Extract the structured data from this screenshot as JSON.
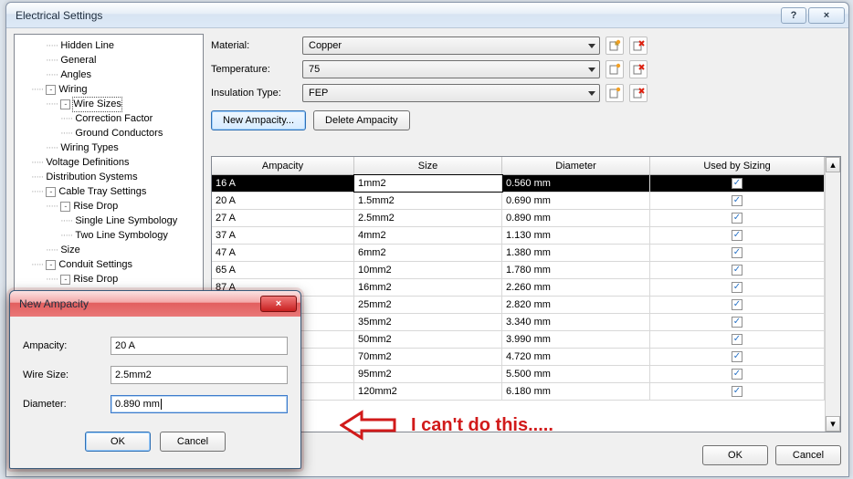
{
  "window": {
    "title": "Electrical Settings",
    "help_icon": "?",
    "close_icon": "×"
  },
  "tree": {
    "items": [
      {
        "ind": 2,
        "exp": null,
        "label": "Hidden Line"
      },
      {
        "ind": 2,
        "exp": null,
        "label": "General"
      },
      {
        "ind": 2,
        "exp": null,
        "label": "Angles"
      },
      {
        "ind": 1,
        "exp": "-",
        "label": "Wiring"
      },
      {
        "ind": 2,
        "exp": "-",
        "label": "Wire Sizes",
        "sel": true
      },
      {
        "ind": 3,
        "exp": null,
        "label": "Correction Factor"
      },
      {
        "ind": 3,
        "exp": null,
        "label": "Ground Conductors"
      },
      {
        "ind": 2,
        "exp": null,
        "label": "Wiring Types"
      },
      {
        "ind": 1,
        "exp": null,
        "label": "Voltage Definitions"
      },
      {
        "ind": 1,
        "exp": null,
        "label": "Distribution Systems"
      },
      {
        "ind": 1,
        "exp": "-",
        "label": "Cable Tray Settings"
      },
      {
        "ind": 2,
        "exp": "-",
        "label": "Rise Drop"
      },
      {
        "ind": 3,
        "exp": null,
        "label": "Single Line Symbology"
      },
      {
        "ind": 3,
        "exp": null,
        "label": "Two Line Symbology"
      },
      {
        "ind": 2,
        "exp": null,
        "label": "Size"
      },
      {
        "ind": 1,
        "exp": "-",
        "label": "Conduit Settings"
      },
      {
        "ind": 2,
        "exp": "-",
        "label": "Rise Drop"
      }
    ]
  },
  "form": {
    "material_label": "Material:",
    "material_value": "Copper",
    "temperature_label": "Temperature:",
    "temperature_value": "75",
    "insulation_label": "Insulation Type:",
    "insulation_value": "FEP",
    "new_ampacity_btn": "New Ampacity...",
    "delete_ampacity_btn": "Delete Ampacity"
  },
  "grid": {
    "headers": {
      "c1": "Ampacity",
      "c2": "Size",
      "c3": "Diameter",
      "c4": "Used by Sizing"
    },
    "rows": [
      {
        "a": "16 A",
        "s": "1mm2",
        "d": "0.560 mm",
        "u": true,
        "sel": true
      },
      {
        "a": "20 A",
        "s": "1.5mm2",
        "d": "0.690 mm",
        "u": true
      },
      {
        "a": "27 A",
        "s": "2.5mm2",
        "d": "0.890 mm",
        "u": true
      },
      {
        "a": "37 A",
        "s": "4mm2",
        "d": "1.130 mm",
        "u": true
      },
      {
        "a": "47 A",
        "s": "6mm2",
        "d": "1.380 mm",
        "u": true
      },
      {
        "a": "65 A",
        "s": "10mm2",
        "d": "1.780 mm",
        "u": true
      },
      {
        "a": "87 A",
        "s": "16mm2",
        "d": "2.260 mm",
        "u": true
      },
      {
        "a": "",
        "s": "25mm2",
        "d": "2.820 mm",
        "u": true
      },
      {
        "a": "",
        "s": "35mm2",
        "d": "3.340 mm",
        "u": true
      },
      {
        "a": "",
        "s": "50mm2",
        "d": "3.990 mm",
        "u": true
      },
      {
        "a": "",
        "s": "70mm2",
        "d": "4.720 mm",
        "u": true
      },
      {
        "a": "",
        "s": "95mm2",
        "d": "5.500 mm",
        "u": true
      },
      {
        "a": "",
        "s": "120mm2",
        "d": "6.180 mm",
        "u": true
      }
    ]
  },
  "footer": {
    "ok": "OK",
    "cancel": "Cancel"
  },
  "modal": {
    "title": "New Ampacity",
    "close_icon": "×",
    "ampacity_label": "Ampacity:",
    "ampacity_value": "20 A",
    "wiresize_label": "Wire Size:",
    "wiresize_value": "2.5mm2",
    "diameter_label": "Diameter:",
    "diameter_value": "0.890 mm",
    "ok": "OK",
    "cancel": "Cancel"
  },
  "annotation": {
    "text": "I can't do this....."
  }
}
